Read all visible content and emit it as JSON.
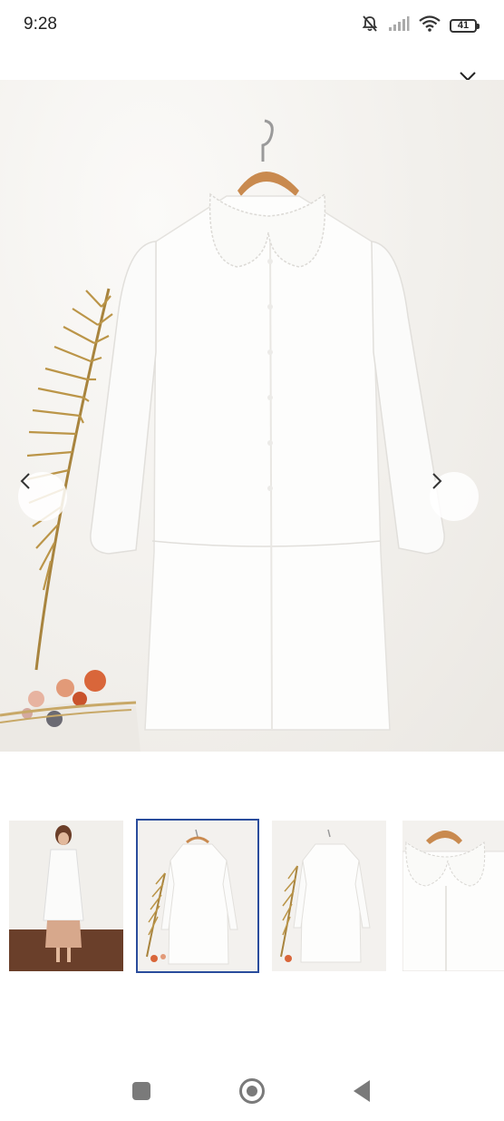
{
  "status_bar": {
    "time": "9:28",
    "battery_level": "41",
    "icons": [
      "mute-bell-icon",
      "signal-icon",
      "wifi-icon",
      "battery-icon"
    ]
  },
  "viewer": {
    "close_icon": "close-icon",
    "prev_icon": "chevron-left-icon",
    "next_icon": "chevron-right-icon",
    "selected_index": 1,
    "thumbnails": [
      {
        "subject": "model-wearing-dress"
      },
      {
        "subject": "dress-on-hanger-with-leaf"
      },
      {
        "subject": "dress-back-view"
      },
      {
        "subject": "collar-detail"
      }
    ]
  },
  "navigation_bar": {
    "icons": [
      "recents-square-icon",
      "home-circle-icon",
      "back-triangle-icon"
    ]
  },
  "colors": {
    "selected_border": "#2a4c9c",
    "background": "#ffffff",
    "nav_icon": "#7a7a7a"
  }
}
